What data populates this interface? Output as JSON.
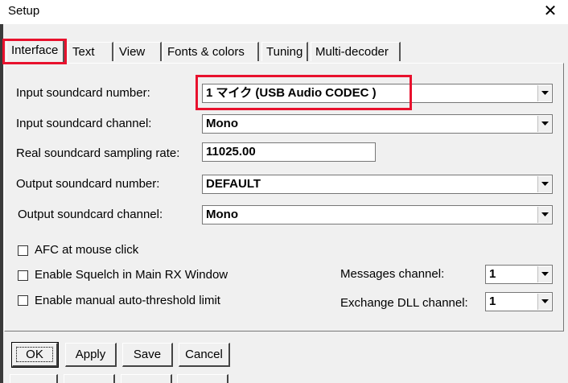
{
  "window": {
    "title": "Setup"
  },
  "tabs": [
    {
      "label": "Interface"
    },
    {
      "label": "Text"
    },
    {
      "label": "View"
    },
    {
      "label": "Fonts & colors"
    },
    {
      "label": "Tuning"
    },
    {
      "label": "Multi-decoder"
    }
  ],
  "form": {
    "input_card_label": "Input soundcard number:",
    "input_card_value": "1 マイク (USB Audio CODEC )",
    "input_channel_label": "Input soundcard channel:",
    "input_channel_value": "Mono",
    "sampling_label": "Real soundcard sampling rate:",
    "sampling_value": "11025.00",
    "output_card_label": "Output soundcard number:",
    "output_card_value": "DEFAULT",
    "output_channel_label": "Output soundcard channel:",
    "output_channel_value": "Mono"
  },
  "options": {
    "afc_label": "AFC at mouse click",
    "squelch_label": "Enable Squelch in Main RX Window",
    "threshold_label": "Enable manual auto-threshold limit",
    "messages_channel_label": "Messages channel:",
    "messages_channel_value": "1",
    "exchange_channel_label": "Exchange DLL channel:",
    "exchange_channel_value": "1"
  },
  "buttons": {
    "ok": "OK",
    "apply": "Apply",
    "save": "Save",
    "cancel": "Cancel"
  },
  "colors": {
    "highlight": "#e8112d",
    "face": "#f0f0f0"
  }
}
